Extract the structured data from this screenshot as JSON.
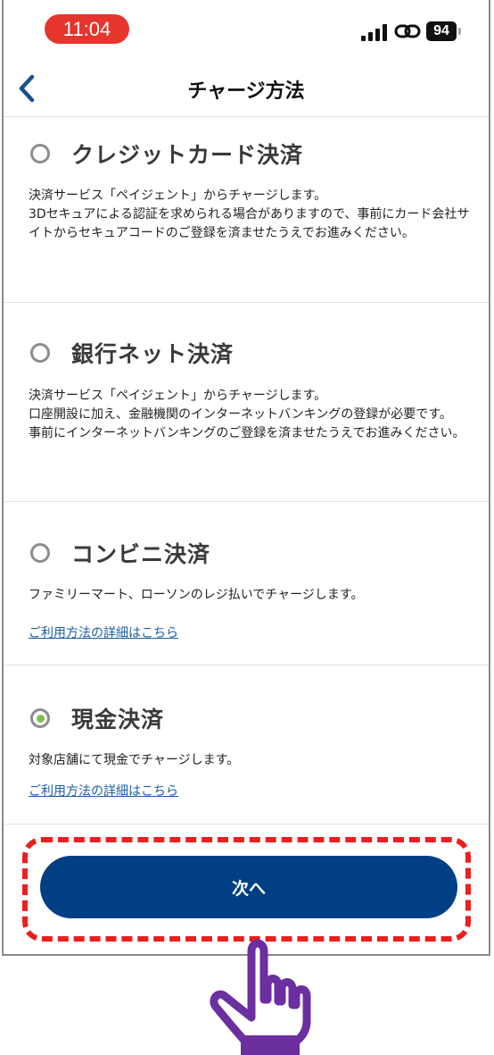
{
  "status_bar": {
    "time": "11:04",
    "battery": "94",
    "accent_color": "#e5352d"
  },
  "header": {
    "title": "チャージ方法",
    "back_icon": "chevron-left-icon"
  },
  "options": [
    {
      "title": "クレジットカード決済",
      "selected": false,
      "description": "決済サービス「ペイジェント」からチャージします。\n3Dセキュアによる認証を求められる場合がありますので、事前にカード会社サイトからセキュアコードのご登録を済ませたうえでお進みください。"
    },
    {
      "title": "銀行ネット決済",
      "selected": false,
      "description": "決済サービス「ペイジェント」からチャージします。\n口座開設に加え、金融機関のインターネットバンキングの登録が必要です。\n事前にインターネットバンキングのご登録を済ませたうえでお進みください。"
    },
    {
      "title": "コンビニ決済",
      "selected": false,
      "description": "ファミリーマート、ローソンのレジ払いでチャージします。",
      "link": "ご利用方法の詳細はこちら"
    },
    {
      "title": "現金決済",
      "selected": true,
      "description": "対象店舗にて現金でチャージします。",
      "link": "ご利用方法の詳細はこちら"
    }
  ],
  "next_button": {
    "label": "次へ",
    "color": "#003f83"
  },
  "annotation": {
    "highlight_color": "#e8201e",
    "pointer_color": "#6b2fa0",
    "pointer_icon": "pointing-hand-icon"
  }
}
